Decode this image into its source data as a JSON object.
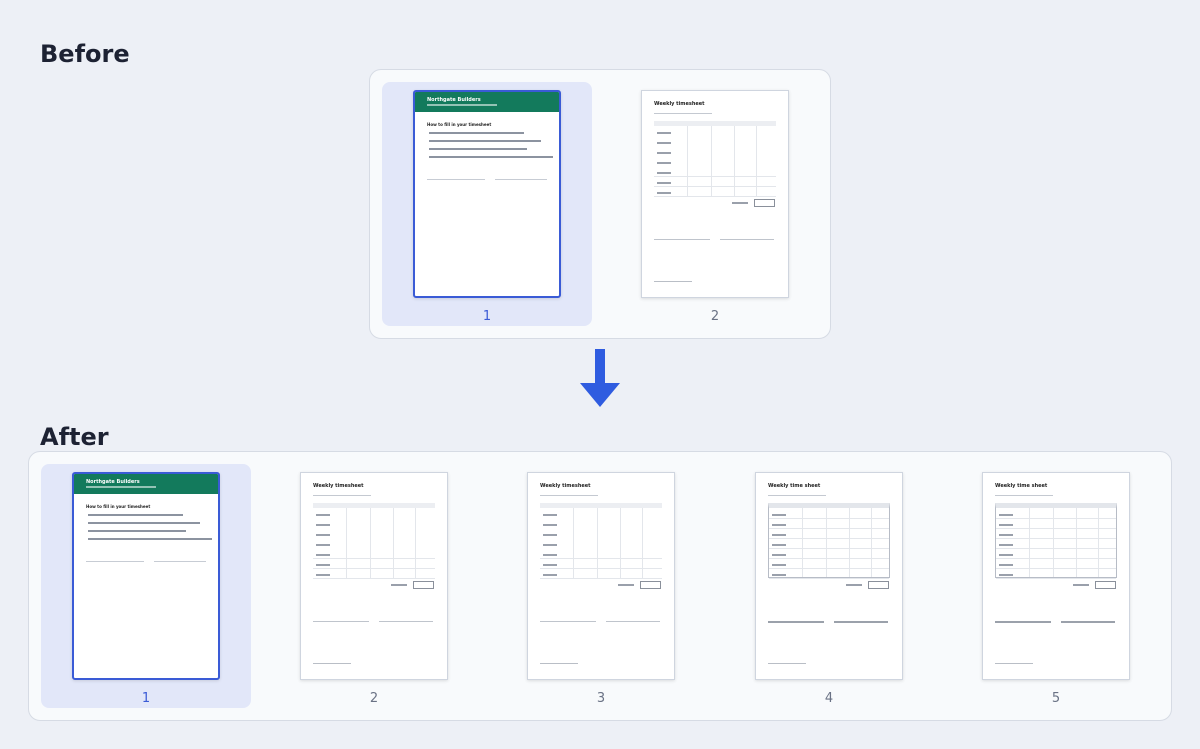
{
  "before": {
    "heading": "Before",
    "pages": [
      {
        "number": "1",
        "kind": "cover",
        "selected": true
      },
      {
        "number": "2",
        "kind": "timesheet",
        "selected": false
      }
    ]
  },
  "after": {
    "heading": "After",
    "pages": [
      {
        "number": "1",
        "kind": "cover",
        "selected": true
      },
      {
        "number": "2",
        "kind": "timesheet",
        "selected": false
      },
      {
        "number": "3",
        "kind": "timesheet",
        "selected": false
      },
      {
        "number": "4",
        "kind": "timesheet-grid",
        "selected": false
      },
      {
        "number": "5",
        "kind": "timesheet-grid",
        "selected": false
      }
    ]
  },
  "cover": {
    "company": "Northgate Builders",
    "instructions_heading": "How to fill in your timesheet"
  },
  "timesheet": {
    "title": "Weekly timesheet",
    "title_grid": "Weekly time sheet"
  },
  "icons": {
    "flow_arrow": "arrow-down-icon"
  },
  "colors": {
    "accent": "#3a5bd6",
    "selected_bg": "#e2e7f9",
    "cover_band": "#137a5c",
    "arrow": "#2f5ce0"
  }
}
